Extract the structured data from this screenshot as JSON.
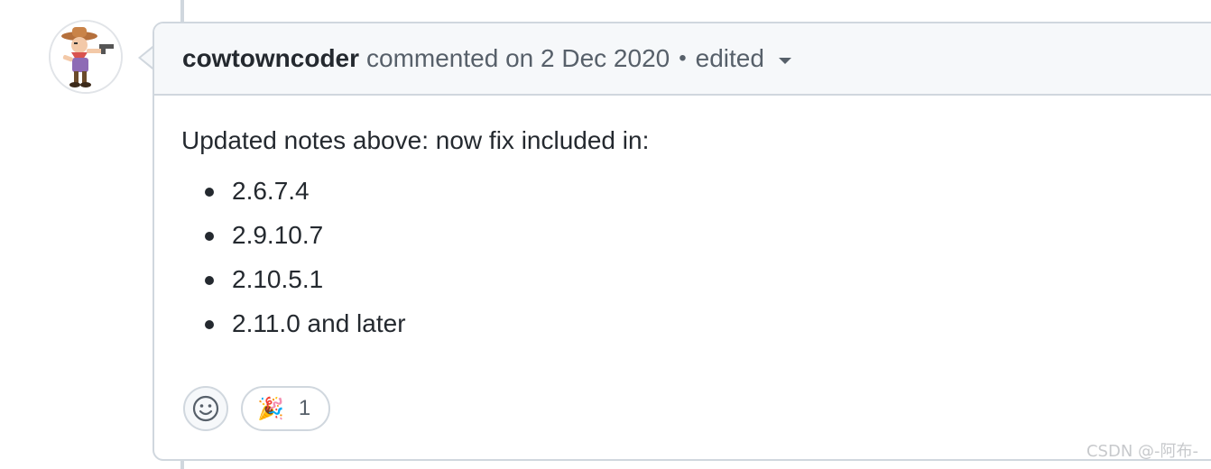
{
  "comment": {
    "author": "cowtowncoder",
    "action": "commented on 2 Dec 2020",
    "separator": "•",
    "edited_label": "edited",
    "body_intro": "Updated notes above: now fix included in:",
    "versions": [
      "2.6.7.4",
      "2.9.10.7",
      "2.10.5.1",
      "2.11.0 and later"
    ]
  },
  "reactions": {
    "add_icon": "smiley-icon",
    "items": [
      {
        "emoji": "🎉",
        "icon": "tada-icon",
        "count": "1"
      }
    ]
  },
  "watermark": "CSDN @-阿布-",
  "colors": {
    "border": "#d0d7de",
    "header_bg": "#f6f8fa",
    "text": "#24292f",
    "muted": "#57606a"
  }
}
